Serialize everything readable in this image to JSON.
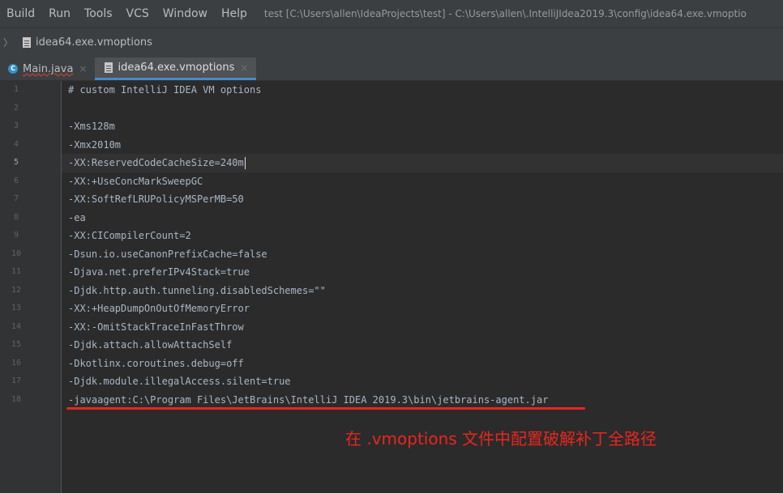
{
  "menubar": {
    "items": [
      "Build",
      "Run",
      "Tools",
      "VCS",
      "Window",
      "Help"
    ],
    "title": "test [C:\\Users\\allen\\IdeaProjects\\test] - C:\\Users\\allen\\.IntelliJIdea2019.3\\config\\idea64.exe.vmoptio"
  },
  "breadcrumb": {
    "file": "idea64.exe.vmoptions"
  },
  "tabs": [
    {
      "label": "Main.java",
      "close": "×",
      "icon": "java-class-icon"
    },
    {
      "label": "idea64.exe.vmoptions",
      "close": "×",
      "icon": "file-icon"
    }
  ],
  "editor": {
    "current_line": 5,
    "lines": [
      "# custom IntelliJ IDEA VM options",
      "",
      "-Xms128m",
      "-Xmx2010m",
      "-XX:ReservedCodeCacheSize=240m",
      "-XX:+UseConcMarkSweepGC",
      "-XX:SoftRefLRUPolicyMSPerMB=50",
      "-ea",
      "-XX:CICompilerCount=2",
      "-Dsun.io.useCanonPrefixCache=false",
      "-Djava.net.preferIPv4Stack=true",
      "-Djdk.http.auth.tunneling.disabledSchemes=\"\"",
      "-XX:+HeapDumpOnOutOfMemoryError",
      "-XX:-OmitStackTraceInFastThrow",
      "-Djdk.attach.allowAttachSelf",
      "-Dkotlinx.coroutines.debug=off",
      "-Djdk.module.illegalAccess.silent=true",
      "-javaagent:C:\\Program Files\\JetBrains\\IntelliJ IDEA 2019.3\\bin\\jetbrains-agent.jar"
    ]
  },
  "annotation": {
    "text": "在 .vmoptions 文件中配置破解补丁全路径",
    "color": "#e8261f"
  },
  "colors": {
    "background": "#2b2b2b",
    "gutter": "#313335",
    "accent": "#4a88c7"
  }
}
